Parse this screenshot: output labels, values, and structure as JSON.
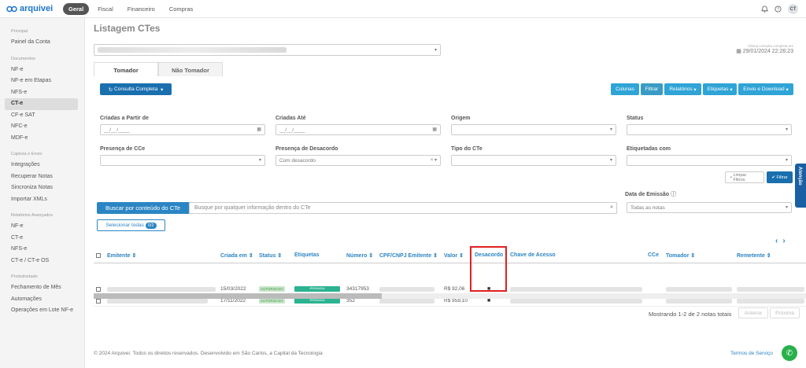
{
  "topbar": {
    "logo_text": "arquivei",
    "nav": [
      "Geral",
      "Fiscal",
      "Financeiro",
      "Compras"
    ],
    "avatar_initials": "CT"
  },
  "sidebar": {
    "sections": [
      {
        "title": "Principal",
        "items": [
          "Painel da Conta"
        ]
      },
      {
        "title": "Documentos",
        "items": [
          "NF-e",
          "NF-e em Etapas",
          "NFS-e",
          "CT-e",
          "CF-e SAT",
          "NFC-e",
          "MDF-e"
        ]
      },
      {
        "title": "Captura e Envio",
        "items": [
          "Integrações",
          "Recuperar Notas",
          "Sincroniza Notas",
          "Importar XMLs"
        ]
      },
      {
        "title": "Relatórios Avançados",
        "items": [
          "NF-e",
          "CT-e",
          "NFS-e",
          "CT-e / CT-e OS"
        ]
      },
      {
        "title": "Produtividade",
        "items": [
          "Fechamento de Mês",
          "Automações",
          "Operações em Lote NF-e"
        ]
      }
    ]
  },
  "main": {
    "title": "Listagem CTes",
    "last_query_label": "Última consulta completa em",
    "last_query_value": "29/01/2024 22:26:23",
    "tabs": [
      "Tomador",
      "Não Tomador"
    ],
    "buttons": {
      "consulta": "Consulta Completa",
      "colunas": "Colunas",
      "filtrar": "Filtrar",
      "relatorios": "Relatórios",
      "etiquetas": "Etiquetas",
      "envio": "Envio e Download",
      "limpar": "Limpar Filtros",
      "filtrar_small": "Filtrar"
    },
    "filters": {
      "criadas_de": "Criadas a Partir de",
      "criadas_ate": "Criadas Até",
      "origem": "Origem",
      "status": "Status",
      "presenca_cce": "Presença de CCe",
      "presenca_desacordo": "Presença de Desacordo",
      "desacordo_value": "Com desacordo",
      "tipo_cte": "Tipo do CTe",
      "etiquetadas": "Etiquetadas com",
      "date_placeholder": "__/__/____",
      "data_emissao": "Data de Emissão",
      "data_emissao_value": "Todas as notas"
    },
    "search": {
      "button": "Buscar por conteúdo do CTe",
      "placeholder": "Busque por qualquer informação dentro do CTe"
    },
    "select_all": {
      "label": "Selecionar todas",
      "count": "0/2"
    },
    "table": {
      "columns": [
        "Emitente",
        "Criada em",
        "Status",
        "Etiquetas",
        "Número",
        "CPF/CNPJ Emitente",
        "Valor",
        "Desacordo",
        "Chave de Acesso",
        "CCe",
        "Tomador",
        "Remetente"
      ],
      "rows": [
        {
          "criada": "15/03/2022",
          "status": "AUTORIZADA",
          "tag": "IPIRANGA",
          "numero": "34317953",
          "valor": "R$ 92,06"
        },
        {
          "criada": "17/11/2022",
          "status": "AUTORIZADA",
          "tag": "IPIRANGA",
          "numero": "352",
          "valor": "R$ 959,10"
        }
      ]
    },
    "pager": {
      "info": "Mostrando 1-2 de 2 notas totais",
      "prev": "Anterior",
      "next": "Próxima"
    },
    "footer": "© 2024 Arquivei. Todos os direitos reservados. Desenvolvido em São Carlos, a Capital da Tecnologia",
    "tos": "Termos de Serviço",
    "side_tab": "Atenção"
  }
}
